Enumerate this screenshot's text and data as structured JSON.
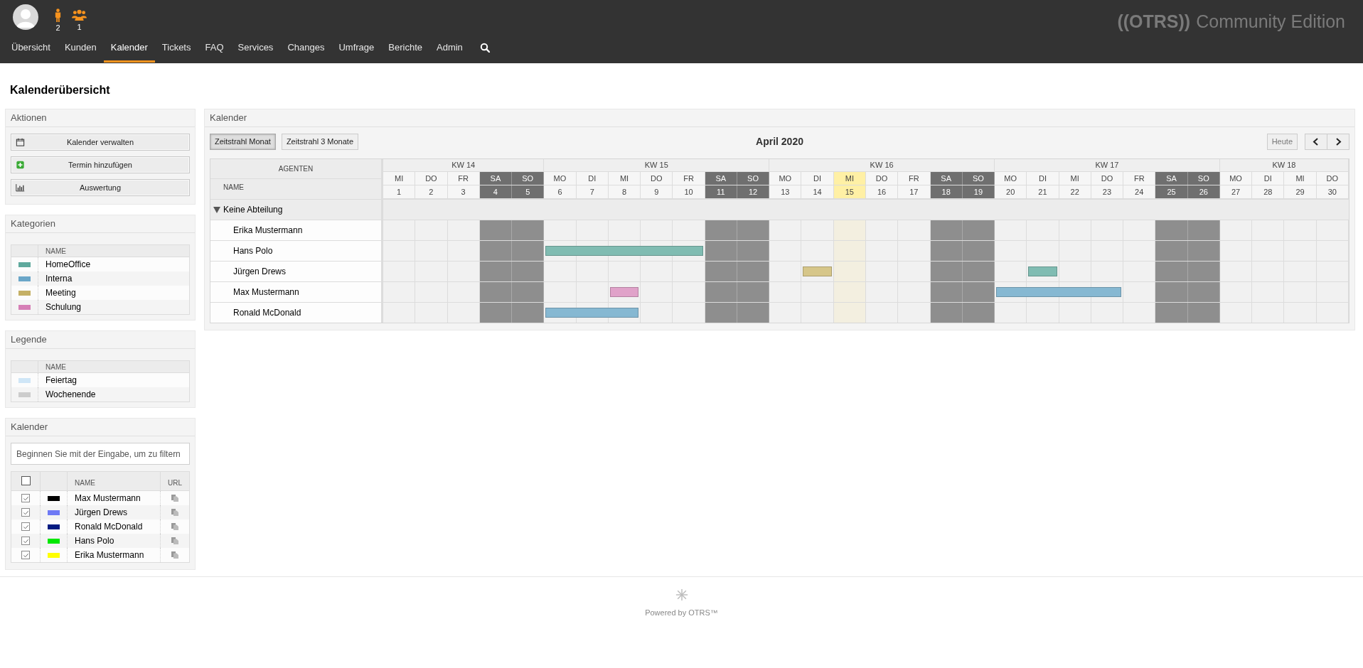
{
  "header": {
    "counters": [
      {
        "kind": "person",
        "count": "2"
      },
      {
        "kind": "group",
        "count": "1"
      }
    ],
    "logo": {
      "mark": "((OTRS))",
      "text": "Community Edition"
    }
  },
  "nav": [
    {
      "label": "Übersicht",
      "selected": false
    },
    {
      "label": "Kunden",
      "selected": false
    },
    {
      "label": "Kalender",
      "selected": true
    },
    {
      "label": "Tickets",
      "selected": false
    },
    {
      "label": "FAQ",
      "selected": false
    },
    {
      "label": "Services",
      "selected": false
    },
    {
      "label": "Changes",
      "selected": false
    },
    {
      "label": "Umfrage",
      "selected": false
    },
    {
      "label": "Berichte",
      "selected": false
    },
    {
      "label": "Admin",
      "selected": false
    }
  ],
  "page_title": "Kalenderübersicht",
  "sidebar": {
    "actions": {
      "title": "Aktionen",
      "buttons": [
        {
          "kind": "calendar",
          "label": "Kalender verwalten"
        },
        {
          "kind": "add",
          "label": "Termin hinzufügen"
        },
        {
          "kind": "chart",
          "label": "Auswertung"
        }
      ]
    },
    "categories": {
      "title": "Kategorien",
      "column": "NAME",
      "items": [
        {
          "name": "HomeOffice",
          "color": "#5fa99d"
        },
        {
          "name": "Interna",
          "color": "#6aa6c8"
        },
        {
          "name": "Meeting",
          "color": "#c5b065"
        },
        {
          "name": "Schulung",
          "color": "#d67fb6"
        }
      ]
    },
    "legend": {
      "title": "Legende",
      "column": "NAME",
      "items": [
        {
          "name": "Feiertag",
          "color": "#cfe6f7"
        },
        {
          "name": "Wochenende",
          "color": "#cccccc"
        }
      ]
    },
    "calendars": {
      "title": "Kalender",
      "filter_placeholder": "Beginnen Sie mit der Eingabe, um zu filtern",
      "name_column": "NAME",
      "url_column": "URL",
      "all_checked": false,
      "items": [
        {
          "name": "Max Mustermann",
          "color": "#000000",
          "checked": true
        },
        {
          "name": "Jürgen Drews",
          "color": "#6f7af5",
          "checked": true
        },
        {
          "name": "Ronald McDonald",
          "color": "#001a80",
          "checked": true
        },
        {
          "name": "Hans Polo",
          "color": "#00e800",
          "checked": true
        },
        {
          "name": "Erika Mustermann",
          "color": "#ffff00",
          "checked": true
        }
      ]
    }
  },
  "calendar": {
    "title": "Kalender",
    "views": [
      {
        "label": "Zeitstrahl Monat",
        "selected": true
      },
      {
        "label": "Zeitstrahl 3 Monate",
        "selected": false
      }
    ],
    "period": "April 2020",
    "today_button": "Heute",
    "agents_header": "AGENTEN",
    "name_header": "NAME",
    "weeks": [
      {
        "label": "KW 14",
        "days": [
          {
            "weekday": "MI",
            "day": "1",
            "weekend": false,
            "today": false
          },
          {
            "weekday": "DO",
            "day": "2",
            "weekend": false,
            "today": false
          },
          {
            "weekday": "FR",
            "day": "3",
            "weekend": false,
            "today": false
          },
          {
            "weekday": "SA",
            "day": "4",
            "weekend": true,
            "today": false
          },
          {
            "weekday": "SO",
            "day": "5",
            "weekend": true,
            "today": false
          }
        ]
      },
      {
        "label": "KW 15",
        "days": [
          {
            "weekday": "MO",
            "day": "6",
            "weekend": false,
            "today": false
          },
          {
            "weekday": "DI",
            "day": "7",
            "weekend": false,
            "today": false
          },
          {
            "weekday": "MI",
            "day": "8",
            "weekend": false,
            "today": false
          },
          {
            "weekday": "DO",
            "day": "9",
            "weekend": false,
            "today": false
          },
          {
            "weekday": "FR",
            "day": "10",
            "weekend": false,
            "today": false
          },
          {
            "weekday": "SA",
            "day": "11",
            "weekend": true,
            "today": false
          },
          {
            "weekday": "SO",
            "day": "12",
            "weekend": true,
            "today": false
          }
        ]
      },
      {
        "label": "KW 16",
        "days": [
          {
            "weekday": "MO",
            "day": "13",
            "weekend": false,
            "today": false
          },
          {
            "weekday": "DI",
            "day": "14",
            "weekend": false,
            "today": false
          },
          {
            "weekday": "MI",
            "day": "15",
            "weekend": false,
            "today": true
          },
          {
            "weekday": "DO",
            "day": "16",
            "weekend": false,
            "today": false
          },
          {
            "weekday": "FR",
            "day": "17",
            "weekend": false,
            "today": false
          },
          {
            "weekday": "SA",
            "day": "18",
            "weekend": true,
            "today": false
          },
          {
            "weekday": "SO",
            "day": "19",
            "weekend": true,
            "today": false
          }
        ]
      },
      {
        "label": "KW 17",
        "days": [
          {
            "weekday": "MO",
            "day": "20",
            "weekend": false,
            "today": false
          },
          {
            "weekday": "DI",
            "day": "21",
            "weekend": false,
            "today": false
          },
          {
            "weekday": "MI",
            "day": "22",
            "weekend": false,
            "today": false
          },
          {
            "weekday": "DO",
            "day": "23",
            "weekend": false,
            "today": false
          },
          {
            "weekday": "FR",
            "day": "24",
            "weekend": false,
            "today": false
          },
          {
            "weekday": "SA",
            "day": "25",
            "weekend": true,
            "today": false
          },
          {
            "weekday": "SO",
            "day": "26",
            "weekend": true,
            "today": false
          }
        ]
      },
      {
        "label": "KW 18",
        "days": [
          {
            "weekday": "MO",
            "day": "27",
            "weekend": false,
            "today": false
          },
          {
            "weekday": "DI",
            "day": "28",
            "weekend": false,
            "today": false
          },
          {
            "weekday": "MI",
            "day": "29",
            "weekend": false,
            "today": false
          },
          {
            "weekday": "DO",
            "day": "30",
            "weekend": false,
            "today": false
          }
        ]
      }
    ],
    "group": {
      "label": "Keine Abteilung",
      "expanded": true
    },
    "agents": [
      {
        "name": "Erika Mustermann",
        "cells": [
          {
            "booked": false
          },
          {
            "booked": false
          },
          {
            "booked": false
          },
          {
            "booked": false
          },
          {
            "booked": false
          },
          {
            "booked": false
          },
          {
            "booked": false
          },
          {
            "booked": false
          },
          {
            "booked": false
          },
          {
            "booked": false
          },
          {
            "booked": false
          },
          {
            "booked": false
          },
          {
            "booked": false
          },
          {
            "booked": false
          },
          {
            "booked": false
          },
          {
            "booked": false
          },
          {
            "booked": false
          },
          {
            "booked": false
          },
          {
            "booked": false
          },
          {
            "booked": false
          },
          {
            "booked": false
          },
          {
            "booked": false
          },
          {
            "booked": false
          },
          {
            "booked": false
          },
          {
            "booked": false
          },
          {
            "booked": false
          },
          {
            "booked": false
          },
          {
            "booked": false
          },
          {
            "booked": false
          },
          {
            "booked": false
          }
        ]
      },
      {
        "name": "Hans Polo",
        "cells": [
          {
            "booked": false
          },
          {
            "booked": false
          },
          {
            "booked": false
          },
          {
            "booked": false
          },
          {
            "booked": false
          },
          {
            "booked": true,
            "color": "#80bcb2"
          },
          {
            "booked": true,
            "color": "#80bcb2"
          },
          {
            "booked": true,
            "color": "#80bcb2"
          },
          {
            "booked": true,
            "color": "#80bcb2"
          },
          {
            "booked": true,
            "color": "#80bcb2"
          },
          {
            "booked": false
          },
          {
            "booked": false
          },
          {
            "booked": false
          },
          {
            "booked": false
          },
          {
            "booked": false
          },
          {
            "booked": false
          },
          {
            "booked": false
          },
          {
            "booked": false
          },
          {
            "booked": false
          },
          {
            "booked": false
          },
          {
            "booked": false
          },
          {
            "booked": false
          },
          {
            "booked": false
          },
          {
            "booked": false
          },
          {
            "booked": false
          },
          {
            "booked": false
          },
          {
            "booked": false
          },
          {
            "booked": false
          },
          {
            "booked": false
          },
          {
            "booked": false
          }
        ]
      },
      {
        "name": "Jürgen Drews",
        "cells": [
          {
            "booked": false
          },
          {
            "booked": false
          },
          {
            "booked": false
          },
          {
            "booked": false
          },
          {
            "booked": false
          },
          {
            "booked": false
          },
          {
            "booked": false
          },
          {
            "booked": false
          },
          {
            "booked": false
          },
          {
            "booked": false
          },
          {
            "booked": false
          },
          {
            "booked": false
          },
          {
            "booked": false
          },
          {
            "booked": true,
            "color": "#d6c689"
          },
          {
            "booked": false
          },
          {
            "booked": false
          },
          {
            "booked": false
          },
          {
            "booked": false
          },
          {
            "booked": false
          },
          {
            "booked": false
          },
          {
            "booked": true,
            "color": "#80bcb2"
          },
          {
            "booked": false
          },
          {
            "booked": false
          },
          {
            "booked": false
          },
          {
            "booked": false
          },
          {
            "booked": false
          },
          {
            "booked": false
          },
          {
            "booked": false
          },
          {
            "booked": false
          },
          {
            "booked": false
          }
        ]
      },
      {
        "name": "Max Mustermann",
        "cells": [
          {
            "booked": false
          },
          {
            "booked": false
          },
          {
            "booked": false
          },
          {
            "booked": false
          },
          {
            "booked": false
          },
          {
            "booked": false
          },
          {
            "booked": false
          },
          {
            "booked": true,
            "color": "#e0a2c9"
          },
          {
            "booked": false
          },
          {
            "booked": false
          },
          {
            "booked": false
          },
          {
            "booked": false
          },
          {
            "booked": false
          },
          {
            "booked": false
          },
          {
            "booked": false
          },
          {
            "booked": false
          },
          {
            "booked": false
          },
          {
            "booked": false
          },
          {
            "booked": false
          },
          {
            "booked": true,
            "color": "#86b8d2"
          },
          {
            "booked": true,
            "color": "#86b8d2"
          },
          {
            "booked": true,
            "color": "#86b8d2"
          },
          {
            "booked": true,
            "color": "#86b8d2"
          },
          {
            "booked": false
          },
          {
            "booked": false
          },
          {
            "booked": false
          },
          {
            "booked": false
          },
          {
            "booked": false
          },
          {
            "booked": false
          },
          {
            "booked": false
          }
        ]
      },
      {
        "name": "Ronald McDonald",
        "cells": [
          {
            "booked": false
          },
          {
            "booked": false
          },
          {
            "booked": false
          },
          {
            "booked": false
          },
          {
            "booked": false
          },
          {
            "booked": true,
            "color": "#86b8d2"
          },
          {
            "booked": true,
            "color": "#86b8d2"
          },
          {
            "booked": true,
            "color": "#86b8d2"
          },
          {
            "booked": false
          },
          {
            "booked": false
          },
          {
            "booked": false
          },
          {
            "booked": false
          },
          {
            "booked": false
          },
          {
            "booked": false
          },
          {
            "booked": false
          },
          {
            "booked": false
          },
          {
            "booked": false
          },
          {
            "booked": false
          },
          {
            "booked": false
          },
          {
            "booked": false
          },
          {
            "booked": false
          },
          {
            "booked": false
          },
          {
            "booked": false
          },
          {
            "booked": false
          },
          {
            "booked": false
          },
          {
            "booked": false
          },
          {
            "booked": false
          },
          {
            "booked": false
          },
          {
            "booked": false
          },
          {
            "booked": false
          }
        ]
      }
    ]
  },
  "footer": {
    "text": "Powered by OTRS™"
  }
}
